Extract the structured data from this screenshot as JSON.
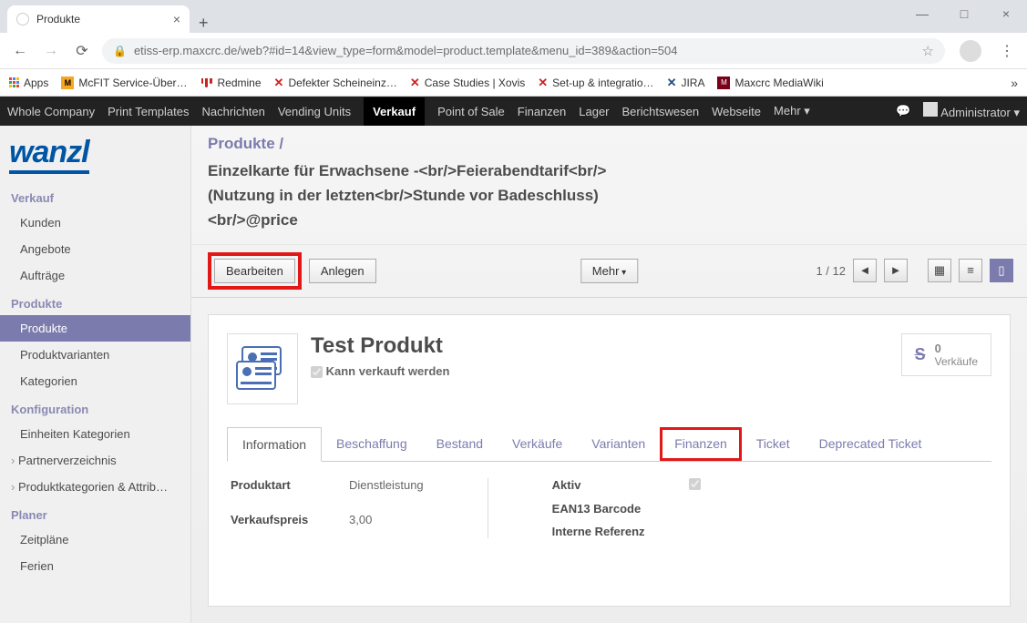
{
  "browser": {
    "tab_title": "Produkte",
    "url": "etiss-erp.maxcrc.de/web?#id=14&view_type=form&model=product.template&menu_id=389&action=504",
    "bookmarks": [
      "Apps",
      "McFIT Service-Über…",
      "Redmine",
      "Defekter Scheineinz…",
      "Case Studies | Xovis",
      "Set-up & integratio…",
      "JIRA",
      "Maxcrc MediaWiki"
    ]
  },
  "top_nav": {
    "items": [
      "Whole Company",
      "Print Templates",
      "Nachrichten",
      "Vending Units",
      "Verkauf",
      "Point of Sale",
      "Finanzen",
      "Lager",
      "Berichtswesen",
      "Webseite",
      "Mehr"
    ],
    "active": "Verkauf",
    "user": "Administrator"
  },
  "sidebar": {
    "logo": "wanzl",
    "sections": [
      {
        "title": "Verkauf",
        "items": [
          "Kunden",
          "Angebote",
          "Aufträge"
        ]
      },
      {
        "title": "Produkte",
        "items": [
          "Produkte",
          "Produktvarianten",
          "Kategorien"
        ],
        "active": "Produkte"
      },
      {
        "title": "Konfiguration",
        "items": [
          "Einheiten Kategorien",
          "Partnerverzeichnis",
          "Produktkategorien & Attrib…"
        ]
      },
      {
        "title": "Planer",
        "items": [
          "Zeitpläne",
          "Ferien"
        ]
      }
    ]
  },
  "breadcrumb": {
    "root": "Produkte",
    "sep": "/"
  },
  "page_title_lines": [
    "Einzelkarte für Erwachsene -<br/>Feierabendtarif<br/>",
    "(Nutzung in der letzten<br/>Stunde vor Badeschluss)",
    "<br/>@price"
  ],
  "actions": {
    "edit": "Bearbeiten",
    "create": "Anlegen",
    "more": "Mehr"
  },
  "pager": {
    "pos": "1 / 12"
  },
  "product": {
    "name": "Test Produkt",
    "can_be_sold": "Kann verkauft werden",
    "can_be_sold_checked": true,
    "stat": {
      "count": "0",
      "label": "Verkäufe"
    },
    "tabs": [
      "Information",
      "Beschaffung",
      "Bestand",
      "Verkäufe",
      "Varianten",
      "Finanzen",
      "Ticket",
      "Deprecated Ticket"
    ],
    "active_tab": "Information",
    "highlight_tab": "Finanzen",
    "fields_left": [
      {
        "label": "Produktart",
        "value": "Dienstleistung"
      },
      {
        "label": "Verkaufspreis",
        "value": "3,00"
      }
    ],
    "fields_right": [
      {
        "label": "Aktiv",
        "value": "",
        "check": true
      },
      {
        "label": "EAN13 Barcode",
        "value": ""
      },
      {
        "label": "Interne Referenz",
        "value": ""
      }
    ]
  }
}
